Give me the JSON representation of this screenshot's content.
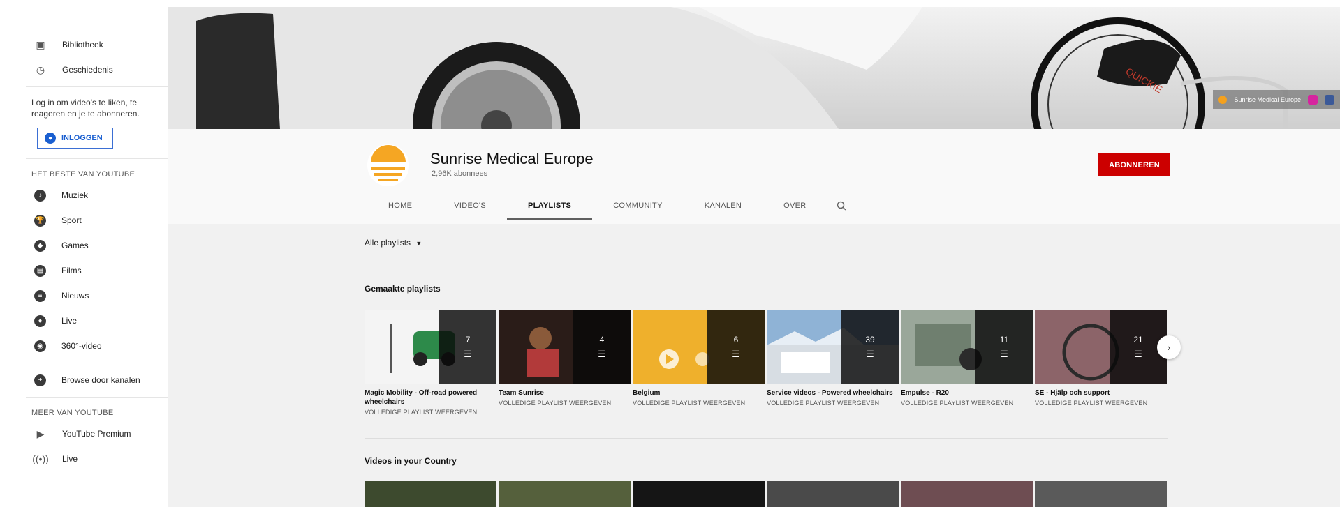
{
  "sidebar": {
    "top_items": [
      {
        "icon": "library-icon",
        "label": "Bibliotheek"
      },
      {
        "icon": "history-icon",
        "label": "Geschiedenis"
      }
    ],
    "login_note": "Log in om video's te liken, te reageren en je te abonneren.",
    "login_button": "INLOGGEN",
    "best_heading": "HET BESTE VAN YOUTUBE",
    "best_items": [
      {
        "icon": "music-icon",
        "label": "Muziek"
      },
      {
        "icon": "sport-icon",
        "label": "Sport"
      },
      {
        "icon": "games-icon",
        "label": "Games"
      },
      {
        "icon": "films-icon",
        "label": "Films"
      },
      {
        "icon": "news-icon",
        "label": "Nieuws"
      },
      {
        "icon": "live-icon",
        "label": "Live"
      },
      {
        "icon": "360-video-icon",
        "label": "360°-video"
      }
    ],
    "browse_channels": "Browse door kanalen",
    "more_heading": "MEER VAN YOUTUBE",
    "more_items": [
      {
        "icon": "youtube-premium-icon",
        "label": "YouTube Premium"
      },
      {
        "icon": "live-broadcast-icon",
        "label": "Live"
      }
    ]
  },
  "banner": {
    "social_label": "Sunrise Medical Europe"
  },
  "channel": {
    "name": "Sunrise Medical Europe",
    "subscribers": "2,96K abonnees",
    "subscribe_label": "ABONNEREN",
    "tabs": [
      "HOME",
      "VIDEO'S",
      "PLAYLISTS",
      "COMMUNITY",
      "KANALEN",
      "OVER"
    ],
    "active_tab": "PLAYLISTS"
  },
  "content": {
    "filter_label": "Alle playlists",
    "section1_title": "Gemaakte playlists",
    "section2_title": "Videos in your Country",
    "playlists": [
      {
        "count": "7",
        "title": "Magic Mobility - Off-road powered wheelchairs",
        "link": "VOLLEDIGE PLAYLIST WEERGEVEN",
        "thumb": "#f4f4f4"
      },
      {
        "count": "4",
        "title": "Team Sunrise",
        "link": "VOLLEDIGE PLAYLIST WEERGEVEN",
        "thumb": "#3a2a22"
      },
      {
        "count": "6",
        "title": "Belgium",
        "link": "VOLLEDIGE PLAYLIST WEERGEVEN",
        "thumb": "#f0b02a"
      },
      {
        "count": "39",
        "title": "Service videos - Powered wheelchairs",
        "link": "VOLLEDIGE PLAYLIST WEERGEVEN",
        "thumb": "#a9c4dc"
      },
      {
        "count": "11",
        "title": "Empulse - R20",
        "link": "VOLLEDIGE PLAYLIST WEERGEVEN",
        "thumb": "#8a9a8a"
      },
      {
        "count": "21",
        "title": "SE - Hjälp och support",
        "link": "VOLLEDIGE PLAYLIST WEERGEVEN",
        "thumb": "#7a5a5e"
      }
    ]
  }
}
